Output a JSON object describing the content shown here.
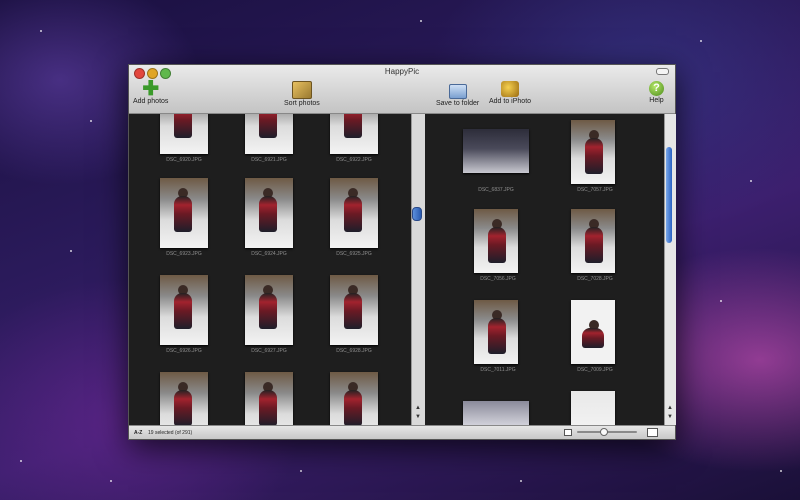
{
  "window": {
    "title": "HappyPic"
  },
  "toolbar": {
    "add_photos": "Add photos",
    "sort_photos": "Sort photos",
    "save_to_folder": "Save to folder",
    "add_to_iphoto": "Add to iPhoto",
    "help": "Help",
    "help_glyph": "?"
  },
  "left_grid": {
    "captions": [
      "DSC_6920.JPG",
      "DSC_6921.JPG",
      "DSC_6922.JPG",
      "DSC_6923.JPG",
      "DSC_6924.JPG",
      "DSC_6925.JPG",
      "DSC_6926.JPG",
      "DSC_6927.JPG",
      "DSC_6928.JPG"
    ]
  },
  "right_grid": {
    "captions": [
      "DSC_6837.JPG",
      "DSC_7057.JPG",
      "DSC_7056.JPG",
      "DSC_7028.JPG",
      "DSC_7011.JPG",
      "DSC_7009.JPG"
    ]
  },
  "status": {
    "sort_label": "A-Z",
    "selection_text": "19 selected (of 291)"
  },
  "colors": {
    "accent_blue": "#2a62c2",
    "add_green": "#3a9a2a"
  }
}
